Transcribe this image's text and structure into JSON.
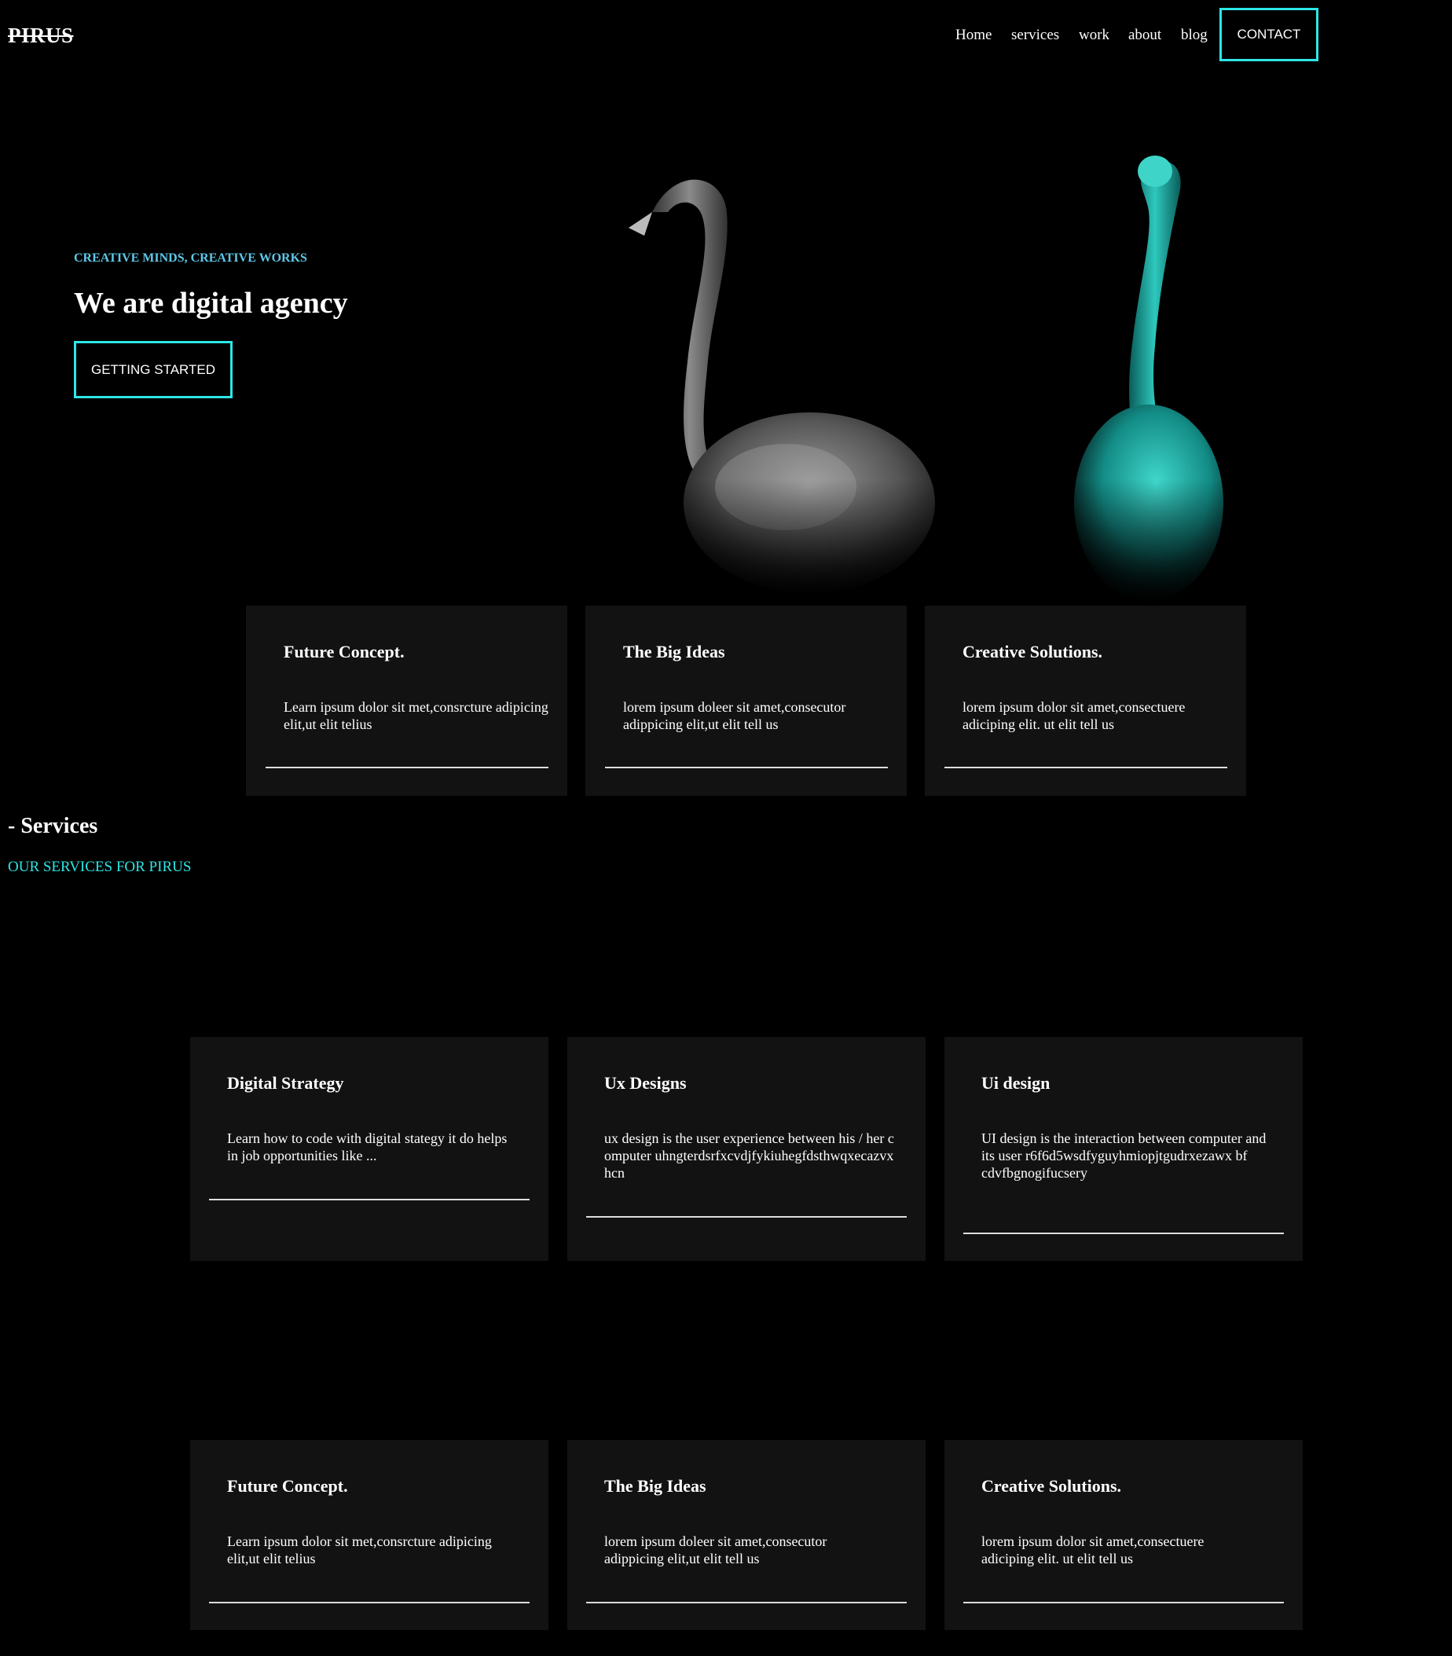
{
  "header": {
    "logo": "PIRUS",
    "nav": [
      "Home",
      "services",
      "work",
      "about",
      "blog"
    ],
    "contact": "CONTACT"
  },
  "hero": {
    "eyebrow": "CREATIVE MINDS, CREATIVE WORKS",
    "title": "We are digital agency",
    "cta": "GETTING STARTED"
  },
  "features": [
    {
      "title": "Future Concept.",
      "text": "Learn ipsum dolor sit met,consrcture adipicing elit,ut elit telius"
    },
    {
      "title": "The Big Ideas",
      "text": "lorem ipsum doleer sit amet,consecutor adippicing elit,ut elit tell us"
    },
    {
      "title": "Creative Solutions.",
      "text": "lorem ipsum dolor sit amet,consectuere adiciping elit. ut elit tell us"
    }
  ],
  "services": {
    "title": "- Services",
    "subtitle": "OUR SERVICES FOR PIRUS",
    "items": [
      {
        "title": "Digital Strategy",
        "text": "Learn how to code with digital stategy it do helps in job opportunities like ..."
      },
      {
        "title": "Ux Designs",
        "text": "ux design is the user experience between his / her computer uhngterdsrfxcvdjfykiuhegfdsthwqxecazvxhcn"
      },
      {
        "title": "Ui design",
        "text": "UI design is the interaction between computer and its user r6f6d5wsdfyguyhmiopjtgudrxezawx bf cdvfbgnogifucsery"
      }
    ]
  },
  "bottom_features": [
    {
      "title": "Future Concept.",
      "text": "Learn ipsum dolor sit met,consrcture adipicing elit,ut elit telius"
    },
    {
      "title": "The Big Ideas",
      "text": "lorem ipsum doleer sit amet,consecutor adippicing elit,ut elit tell us"
    },
    {
      "title": "Creative Solutions.",
      "text": "lorem ipsum dolor sit amet,consectuere adiciping elit. ut elit tell us"
    }
  ],
  "colors": {
    "accent": "#2ee6e6",
    "eyebrow": "#5ec8e8",
    "card_bg": "#121212",
    "background": "#000000"
  }
}
